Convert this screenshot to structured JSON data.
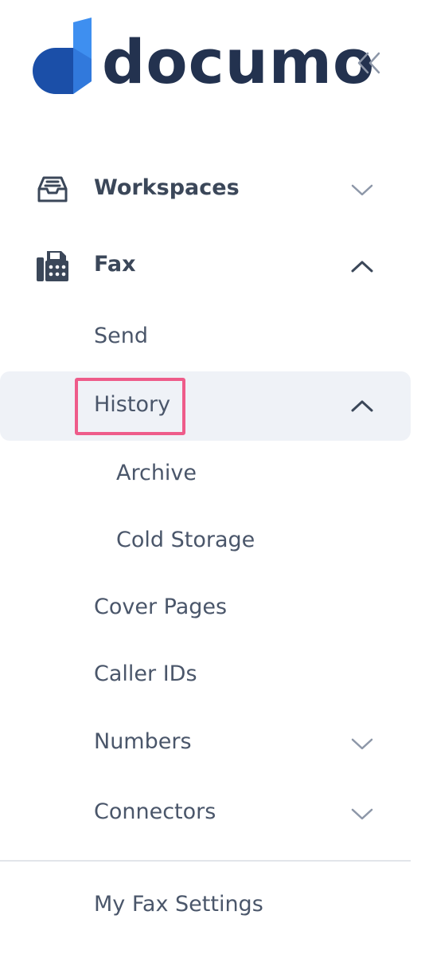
{
  "logo": {
    "text": "documo",
    "icon": "documo-logo-icon"
  },
  "collapse": {
    "icon": "double-chevron-left-icon"
  },
  "nav": {
    "workspaces": {
      "label": "Workspaces",
      "icon": "inbox-tray-icon",
      "chevron": "chevron-down-icon"
    },
    "fax": {
      "label": "Fax",
      "icon": "fax-machine-icon",
      "chevron": "chevron-up-icon"
    },
    "send": {
      "label": "Send"
    },
    "history": {
      "label": "History",
      "chevron": "chevron-up-icon"
    },
    "archive": {
      "label": "Archive"
    },
    "cold_storage": {
      "label": "Cold Storage"
    },
    "cover_pages": {
      "label": "Cover Pages"
    },
    "caller_ids": {
      "label": "Caller IDs"
    },
    "numbers": {
      "label": "Numbers",
      "chevron": "chevron-down-icon"
    },
    "connectors": {
      "label": "Connectors",
      "chevron": "chevron-down-icon"
    },
    "my_fax_settings": {
      "label": "My Fax Settings"
    }
  },
  "colors": {
    "brand_dark": "#23324f",
    "brand_blue": "#1f6fd6",
    "brand_light_blue": "#3e8ff0",
    "active_background": "#eff2f7",
    "highlight_border": "#ee5c8a",
    "text": "#4a566a",
    "chevron": "#8d97a8"
  }
}
